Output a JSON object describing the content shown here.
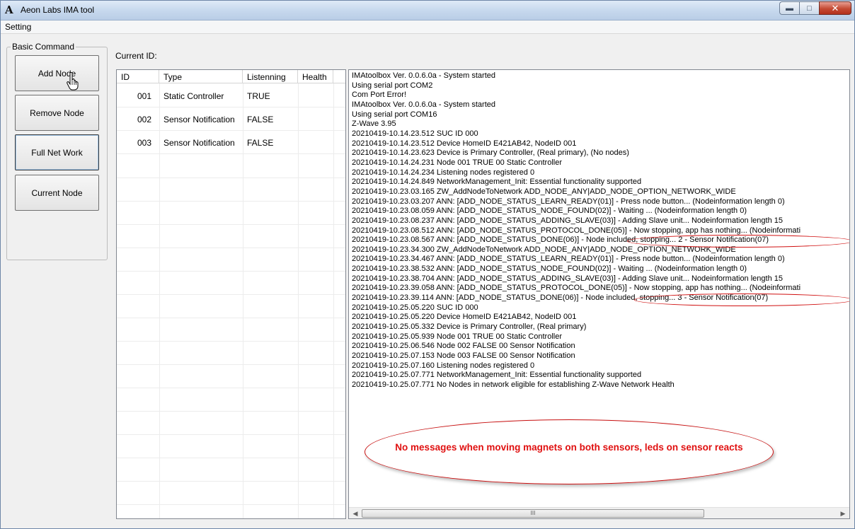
{
  "window": {
    "title": "Aeon Labs IMA tool",
    "logo_text": "A"
  },
  "menu": {
    "items": [
      "Setting"
    ]
  },
  "basic_command": {
    "label": "Basic Command",
    "buttons": [
      "Add Node",
      "Remove Node",
      "Full Net Work",
      "Current Node"
    ]
  },
  "current_id": {
    "label": "Current ID:"
  },
  "node_table": {
    "columns": [
      "ID",
      "Type",
      "Listenning",
      "Health"
    ],
    "rows": [
      {
        "id": "001",
        "type": "Static Controller",
        "listening": "TRUE",
        "health": ""
      },
      {
        "id": "002",
        "type": "Sensor Notification",
        "listening": "FALSE",
        "health": ""
      },
      {
        "id": "003",
        "type": "Sensor Notification",
        "listening": "FALSE",
        "health": ""
      }
    ]
  },
  "log": {
    "lines": [
      "IMAtoolbox Ver. 0.0.6.0a - System started",
      "Using serial port COM2",
      "Com Port Error!",
      "IMAtoolbox Ver. 0.0.6.0a - System started",
      "Using serial port COM16",
      "Z-Wave 3.95",
      "20210419-10.14.23.512 SUC ID 000",
      "20210419-10.14.23.512 Device HomeID E421AB42, NodeID 001",
      "20210419-10.14.23.623 Device is Primary Controller, (Real primary), (No nodes)",
      "20210419-10.14.24.231 Node 001 TRUE  00 Static Controller",
      "20210419-10.14.24.234 Listening nodes registered 0",
      "20210419-10.14.24.849 NetworkManagement_Init: Essential functionality supported",
      "20210419-10.23.03.165 ZW_AddNodeToNetwork ADD_NODE_ANY|ADD_NODE_OPTION_NETWORK_WIDE",
      "20210419-10.23.03.207 ANN: [ADD_NODE_STATUS_LEARN_READY(01)]      - Press node button... (Nodeinformation length 0)",
      "20210419-10.23.08.059 ANN: [ADD_NODE_STATUS_NODE_FOUND(02)]       - Waiting ... (Nodeinformation length 0)",
      "20210419-10.23.08.237 ANN: [ADD_NODE_STATUS_ADDING_SLAVE(03)]     - Adding Slave unit... Nodeinformation length 15",
      "20210419-10.23.08.512 ANN: [ADD_NODE_STATUS_PROTOCOL_DONE(05)]    - Now stopping, app has nothing... (Nodeinformati",
      "20210419-10.23.08.567 ANN: [ADD_NODE_STATUS_DONE(06)]             - Node included, stopping... 2 - Sensor Notification(07)",
      "20210419-10.23.34.300 ZW_AddNodeToNetwork ADD_NODE_ANY|ADD_NODE_OPTION_NETWORK_WIDE",
      "20210419-10.23.34.467 ANN: [ADD_NODE_STATUS_LEARN_READY(01)]      - Press node button... (Nodeinformation length 0)",
      "20210419-10.23.38.532 ANN: [ADD_NODE_STATUS_NODE_FOUND(02)]       - Waiting ... (Nodeinformation length 0)",
      "20210419-10.23.38.704 ANN: [ADD_NODE_STATUS_ADDING_SLAVE(03)]     - Adding Slave unit... Nodeinformation length 15",
      "20210419-10.23.39.058 ANN: [ADD_NODE_STATUS_PROTOCOL_DONE(05)]    - Now stopping, app has nothing... (Nodeinformati",
      "20210419-10.23.39.114 ANN: [ADD_NODE_STATUS_DONE(06)]             - Node included, stopping... 3 - Sensor Notification(07)",
      "20210419-10.25.05.220 SUC ID 000",
      "20210419-10.25.05.220 Device HomeID E421AB42, NodeID 001",
      "20210419-10.25.05.332 Device is Primary Controller, (Real primary)",
      "20210419-10.25.05.939 Node 001 TRUE  00 Static Controller",
      "20210419-10.25.06.546 Node 002 FALSE 00 Sensor Notification",
      "20210419-10.25.07.153 Node 003 FALSE 00 Sensor Notification",
      "20210419-10.25.07.160 Listening nodes registered 0",
      "20210419-10.25.07.771 NetworkManagement_Init: Essential functionality supported",
      "20210419-10.25.07.771 No Nodes in network eligible for establishing Z-Wave Network Health"
    ],
    "annotation": "No messages when moving magnets on both sensors, leds on sensor reacts",
    "scroll_thumb_grip": "III"
  },
  "colors": {
    "annotation": "#e01010",
    "titlebar": "#c7d9ee"
  }
}
